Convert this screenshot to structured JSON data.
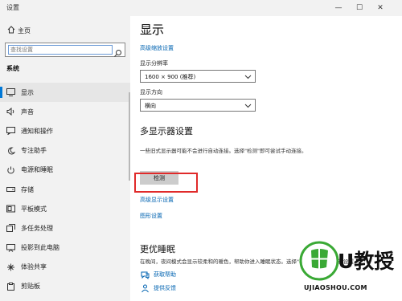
{
  "window": {
    "title": "设置",
    "min": "—",
    "max": "☐",
    "close": "✕"
  },
  "sidebar": {
    "home_label": "主页",
    "search_placeholder": "查找设置",
    "section_label": "系统",
    "items": [
      {
        "label": "显示",
        "icon": "monitor-icon",
        "active": true
      },
      {
        "label": "声音",
        "icon": "speaker-icon",
        "active": false
      },
      {
        "label": "通知和操作",
        "icon": "notification-icon",
        "active": false
      },
      {
        "label": "专注助手",
        "icon": "moon-icon",
        "active": false
      },
      {
        "label": "电源和睡眠",
        "icon": "power-icon",
        "active": false
      },
      {
        "label": "存储",
        "icon": "storage-icon",
        "active": false
      },
      {
        "label": "平板模式",
        "icon": "tablet-icon",
        "active": false
      },
      {
        "label": "多任务处理",
        "icon": "multitask-icon",
        "active": false
      },
      {
        "label": "投影到此电脑",
        "icon": "projection-icon",
        "active": false
      },
      {
        "label": "体验共享",
        "icon": "share-icon",
        "active": false
      },
      {
        "label": "剪贴板",
        "icon": "clipboard-icon",
        "active": false
      }
    ]
  },
  "main": {
    "title": "显示",
    "advanced_scaling_link": "高级缩放设置",
    "resolution_label": "显示分辨率",
    "resolution_value": "1600 × 900 (推荐)",
    "orientation_label": "显示方向",
    "orientation_value": "横向",
    "multi_display_heading": "多显示器设置",
    "multi_display_desc": "一些旧式显示器可能不会进行自动连接。选择\"检测\"即可尝试手动连接。",
    "detect_button": "检测",
    "advanced_display_link": "高级显示设置",
    "graphics_link": "图形设置",
    "sleep_heading": "更优睡眠",
    "sleep_desc": "在晚间，夜间模式会显示较柔和的暖色，帮助你进入睡眠状态。选择\"夜间模式设置\"进行设置。",
    "get_help": "获取帮助",
    "feedback": "提供反馈"
  },
  "watermark": {
    "brand": "U教授",
    "url": "UJIAOSHOU.COM"
  },
  "colors": {
    "accent": "#0078d7",
    "link": "#0063b1",
    "highlight": "#e02a2a",
    "watermark_green": "#3aa935"
  }
}
